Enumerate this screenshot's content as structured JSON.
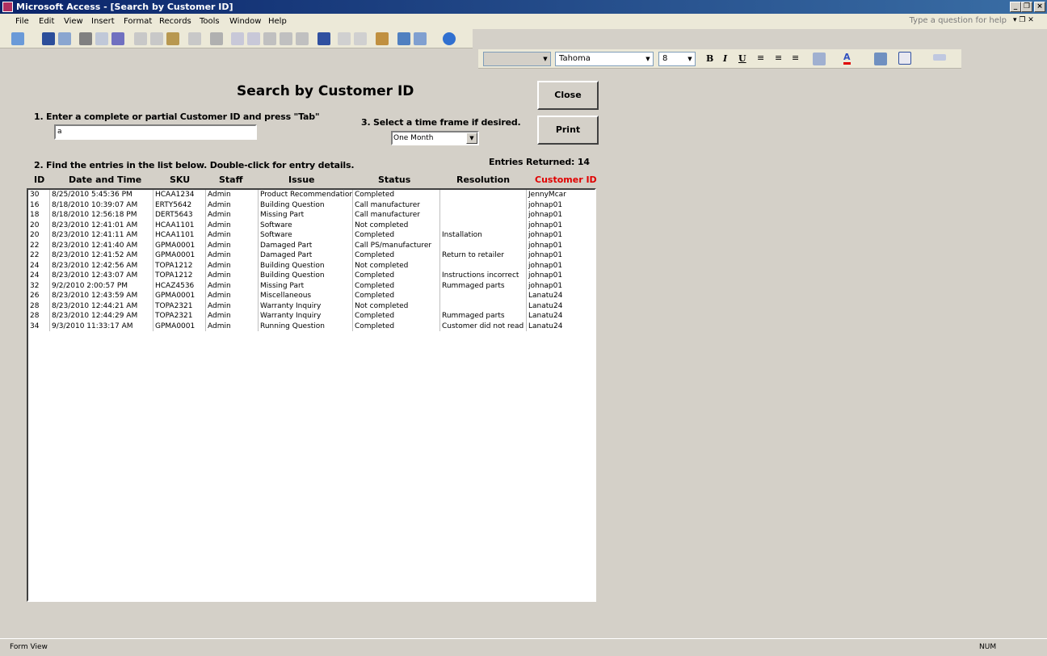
{
  "window": {
    "title": "Microsoft Access - [Search by Customer ID]"
  },
  "menu": [
    "File",
    "Edit",
    "View",
    "Insert",
    "Format",
    "Records",
    "Tools",
    "Window",
    "Help"
  ],
  "help_placeholder": "Type a question for help",
  "format_toolbar": {
    "font": "Tahoma",
    "size": "8",
    "bold": "B",
    "italic": "I",
    "underline": "U"
  },
  "form": {
    "title": "Search by Customer ID",
    "step1": "1. Enter a complete or partial Customer ID and press \"Tab\"",
    "search_value": "a",
    "step3": "3. Select a time frame if desired.",
    "timeframe": "One Month",
    "step2": "2. Find the entries in the list below. Double-click for entry details.",
    "entries_label": "Entries Returned:",
    "entries_count": "14",
    "close": "Close",
    "print": "Print",
    "columns": [
      "ID",
      "Date and Time",
      "SKU",
      "Staff",
      "Issue",
      "Status",
      "Resolution",
      "Customer ID"
    ],
    "rows": [
      [
        "30",
        "8/25/2010 5:45:36 PM",
        "HCAA1234",
        "Admin",
        "Product Recommendation",
        "Completed",
        "",
        "JennyMcar"
      ],
      [
        "16",
        "8/18/2010 10:39:07 AM",
        "ERTY5642",
        "Admin",
        "Building Question",
        "Call manufacturer",
        "",
        "johnap01"
      ],
      [
        "18",
        "8/18/2010 12:56:18 PM",
        "DERT5643",
        "Admin",
        "Missing Part",
        "Call manufacturer",
        "",
        "johnap01"
      ],
      [
        "20",
        "8/23/2010 12:41:01 AM",
        "HCAA1101",
        "Admin",
        "Software",
        "Not completed",
        "",
        "johnap01"
      ],
      [
        "20",
        "8/23/2010 12:41:11 AM",
        "HCAA1101",
        "Admin",
        "Software",
        "Completed",
        "Installation",
        "johnap01"
      ],
      [
        "22",
        "8/23/2010 12:41:40 AM",
        "GPMA0001",
        "Admin",
        "Damaged Part",
        "Call PS/manufacturer",
        "",
        "johnap01"
      ],
      [
        "22",
        "8/23/2010 12:41:52 AM",
        "GPMA0001",
        "Admin",
        "Damaged Part",
        "Completed",
        "Return to retailer",
        "johnap01"
      ],
      [
        "24",
        "8/23/2010 12:42:56 AM",
        "TOPA1212",
        "Admin",
        "Building Question",
        "Not completed",
        "",
        "johnap01"
      ],
      [
        "24",
        "8/23/2010 12:43:07 AM",
        "TOPA1212",
        "Admin",
        "Building Question",
        "Completed",
        "Instructions incorrect",
        "johnap01"
      ],
      [
        "32",
        "9/2/2010 2:00:57 PM",
        "HCAZ4536",
        "Admin",
        "Missing Part",
        "Completed",
        "Rummaged parts",
        "johnap01"
      ],
      [
        "26",
        "8/23/2010 12:43:59 AM",
        "GPMA0001",
        "Admin",
        "Miscellaneous",
        "Completed",
        "",
        "Lanatu24"
      ],
      [
        "28",
        "8/23/2010 12:44:21 AM",
        "TOPA2321",
        "Admin",
        "Warranty Inquiry",
        "Not completed",
        "",
        "Lanatu24"
      ],
      [
        "28",
        "8/23/2010 12:44:29 AM",
        "TOPA2321",
        "Admin",
        "Warranty Inquiry",
        "Completed",
        "Rummaged parts",
        "Lanatu24"
      ],
      [
        "34",
        "9/3/2010 11:33:17 AM",
        "GPMA0001",
        "Admin",
        "Running Question",
        "Completed",
        "Customer did not read ir",
        "Lanatu24"
      ]
    ]
  },
  "status": {
    "view": "Form View",
    "num": "NUM"
  },
  "colors": {
    "accent_header": "#e00000",
    "title_bar": "#0a246a"
  }
}
